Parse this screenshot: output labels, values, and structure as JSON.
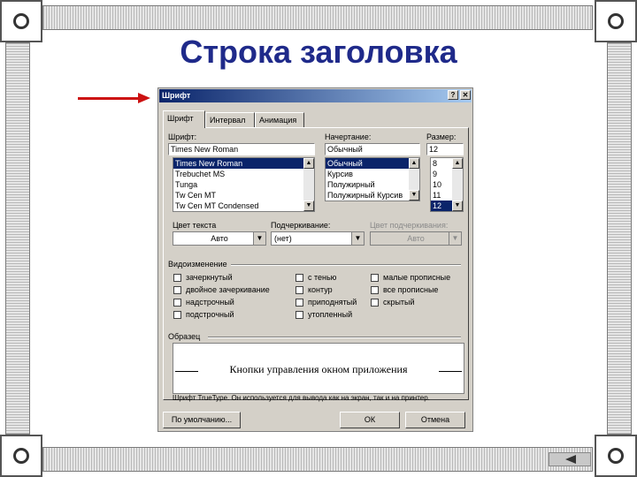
{
  "slide_title": "Строка заголовка",
  "dialog": {
    "title": "Шрифт",
    "help_button": "?",
    "close_button": "✕",
    "tabs": [
      "Шрифт",
      "Интервал",
      "Анимация"
    ],
    "font_label": "Шрифт:",
    "font_value": "Times New Roman",
    "font_list": [
      "Times New Roman",
      "Trebuchet MS",
      "Tunga",
      "Tw Cen MT",
      "Tw Cen MT Condensed"
    ],
    "style_label": "Начертание:",
    "style_value": "Обычный",
    "style_list": [
      "Обычный",
      "Курсив",
      "Полужирный",
      "Полужирный Курсив"
    ],
    "size_label": "Размер:",
    "size_value": "12",
    "size_list": [
      "8",
      "9",
      "10",
      "11",
      "12"
    ],
    "color_label": "Цвет текста",
    "color_value": "Авто",
    "underline_label": "Подчеркивание:",
    "underline_value": "(нет)",
    "underline_color_label": "Цвет подчеркивания:",
    "underline_color_value": "Авто",
    "effects_label": "Видоизменение",
    "effects_col1": [
      "зачеркнутый",
      "двойное зачеркивание",
      "надстрочный",
      "подстрочный"
    ],
    "effects_col2": [
      "с тенью",
      "контур",
      "приподнятый",
      "утопленный"
    ],
    "effects_col3": [
      "малые прописные",
      "все прописные",
      "скрытый"
    ],
    "sample_label": "Образец",
    "sample_text": "Кнопки управления окном приложения",
    "info_text": "Шрифт TrueType. Он используется для вывода как на экран, так и на принтер.",
    "default_button": "По умолчанию...",
    "ok_button": "ОК",
    "cancel_button": "Отмена"
  }
}
